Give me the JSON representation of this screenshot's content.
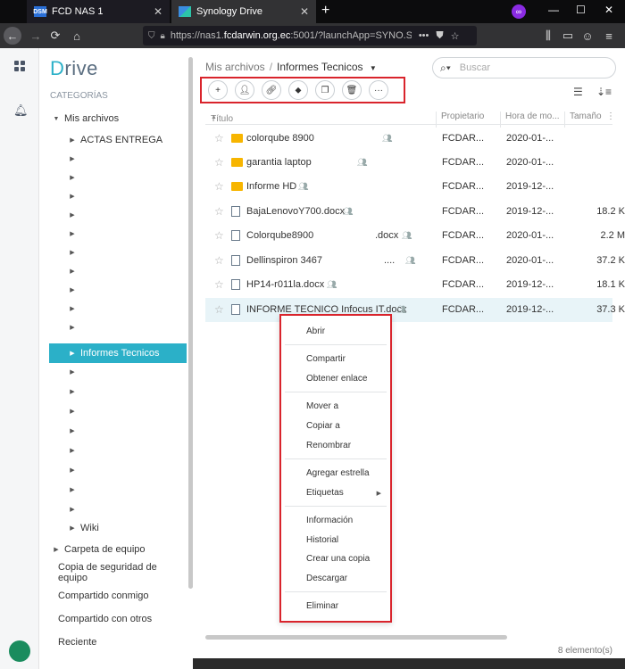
{
  "browser": {
    "tabs": [
      {
        "favicon": "DSM",
        "label": "FCD NAS 1"
      },
      {
        "favicon": "",
        "label": "Synology Drive"
      }
    ],
    "new_tab": "+",
    "url_prefix": "https://nas1.",
    "url_host": "fcdarwin.org.ec",
    "url_rest": ":5001/?launchApp=SYNO.S",
    "icons": {
      "back": "arrow-left-icon",
      "forward": "arrow-right-icon",
      "reload": "reload-icon",
      "home": "home-icon"
    }
  },
  "app": {
    "brand_first": "D",
    "brand_rest": "rive"
  },
  "sidebar": {
    "category_label": "CATEGORÍAS",
    "my_files": "Mis archivos",
    "actas": "ACTAS ENTREGA",
    "informes": "Informes Tecnicos",
    "wiki": "Wiki",
    "team_folder": "Carpeta de equipo",
    "backup": "Copia de seguridad de equipo",
    "shared_with_me": "Compartido conmigo",
    "shared_with_others": "Compartido con otros",
    "recent": "Reciente"
  },
  "main": {
    "breadcrumb_root": "Mis archivos",
    "breadcrumb_sep": "/",
    "breadcrumb_current": "Informes Tecnicos",
    "search_placeholder": "Buscar",
    "columns": {
      "title": "Título",
      "owner": "Propietario",
      "time": "Hora de mo...",
      "size": "Tamaño"
    },
    "files": [
      {
        "name": "colorqube 8900",
        "type": "folder",
        "owner": "FCDAR...",
        "time": "2020-01-...",
        "size": ""
      },
      {
        "name": "garantia laptop",
        "type": "folder",
        "owner": "FCDAR...",
        "time": "2020-01-...",
        "size": ""
      },
      {
        "name": "Informe HD",
        "type": "folder",
        "owner": "FCDAR...",
        "time": "2019-12-...",
        "size": ""
      },
      {
        "name": "BajaLenovoY700.docx",
        "type": "doc",
        "owner": "FCDAR...",
        "time": "2019-12-...",
        "size": "18.2 K"
      },
      {
        "name": "Colorqube8900",
        "ext": ".docx",
        "type": "doc",
        "owner": "FCDAR...",
        "time": "2020-01-...",
        "size": "2.2 M"
      },
      {
        "name": "Dellinspiron 3467",
        "ext": "....",
        "type": "doc",
        "owner": "FCDAR...",
        "time": "2020-01-...",
        "size": "37.2 K"
      },
      {
        "name": "HP14-r011la.docx",
        "type": "doc",
        "owner": "FCDAR...",
        "time": "2019-12-...",
        "size": "18.1 K"
      },
      {
        "name": "INFORME TECNICO Infocus IT.docx",
        "type": "doc",
        "owner": "FCDAR...",
        "time": "2019-12-...",
        "size": "37.3 K"
      }
    ],
    "item_count": "8 elemento(s)"
  },
  "context_menu": {
    "open": "Abrir",
    "share": "Compartir",
    "get_link": "Obtener enlace",
    "move_to": "Mover a",
    "copy_to": "Copiar a",
    "rename": "Renombrar",
    "add_star": "Agregar estrella",
    "tags": "Etiquetas",
    "info": "Información",
    "history": "Historial",
    "make_copy": "Crear una copia",
    "download": "Descargar",
    "delete": "Eliminar"
  },
  "colors": {
    "accent": "#2bb0c8",
    "highlight": "#d9242c",
    "folder": "#f7b500"
  }
}
